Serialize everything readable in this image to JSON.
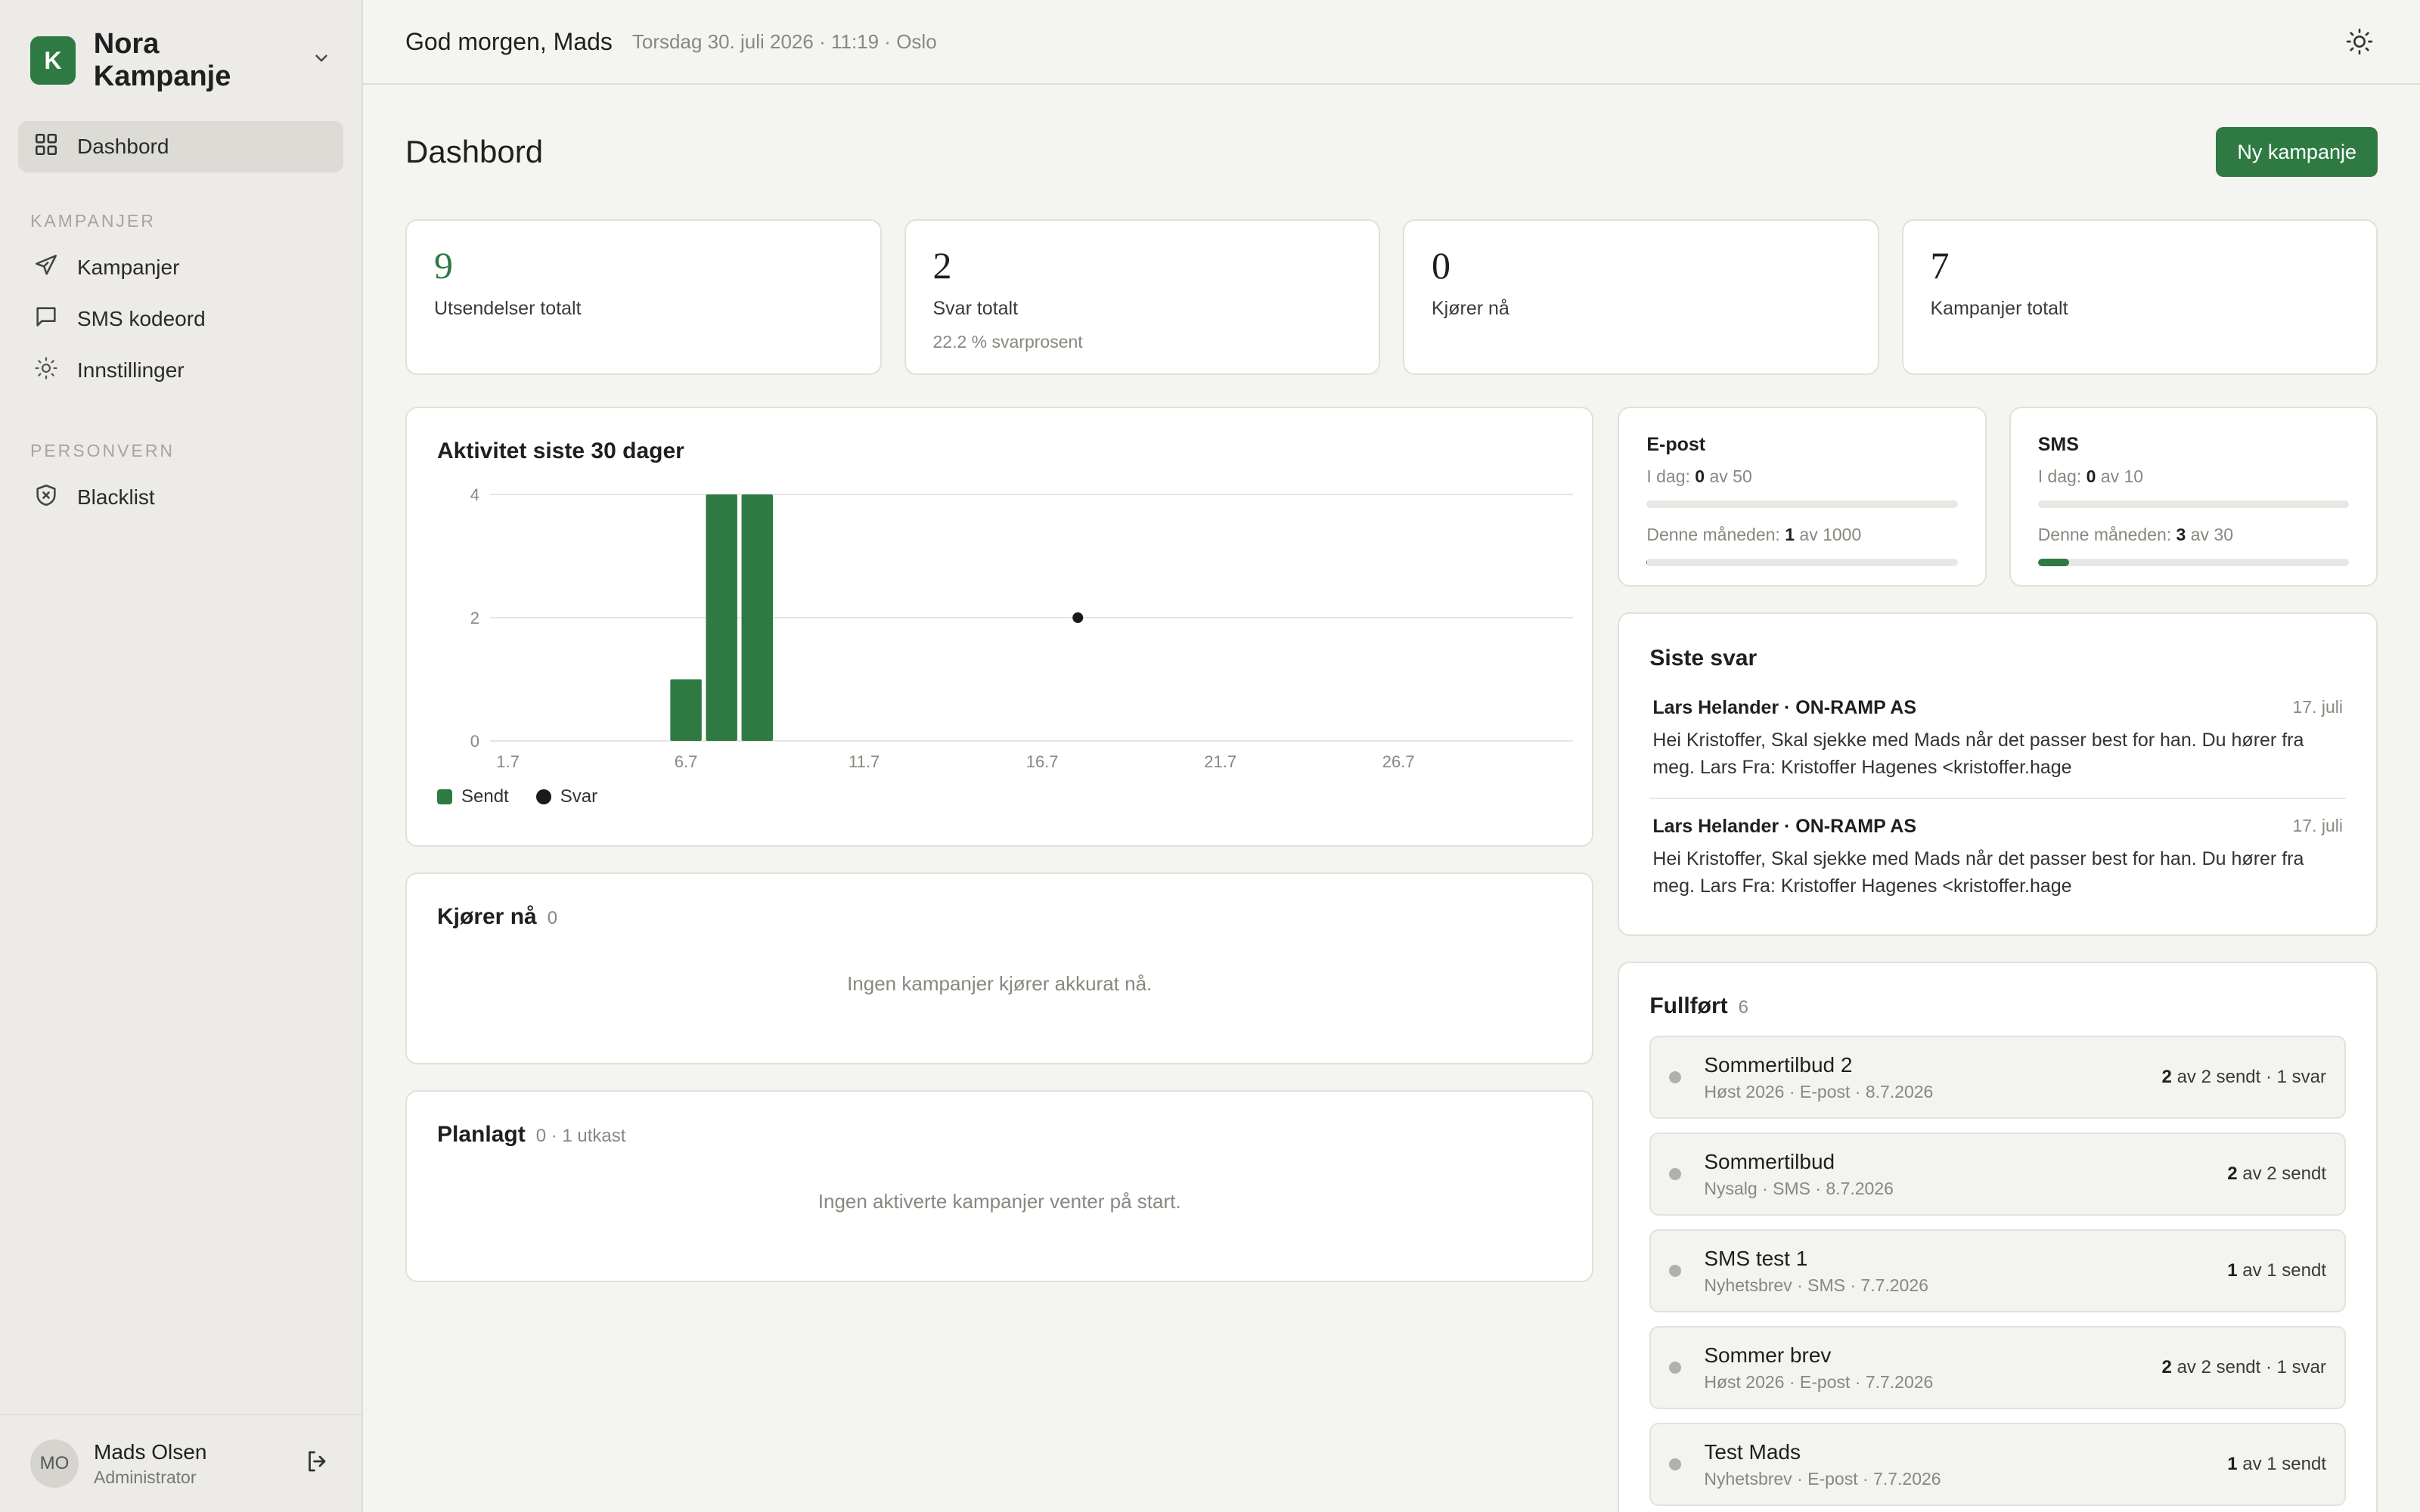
{
  "brand": {
    "logo_letter": "K",
    "name": "Nora Kampanje"
  },
  "nav": {
    "dashboard": "Dashbord",
    "section_campaigns": "KAMPANJER",
    "campaigns": "Kampanjer",
    "sms_codes": "SMS kodeord",
    "settings": "Innstillinger",
    "section_privacy": "PERSONVERN",
    "blacklist": "Blacklist"
  },
  "user": {
    "initials": "MO",
    "name": "Mads Olsen",
    "role": "Administrator"
  },
  "topbar": {
    "greeting": "God morgen, Mads",
    "datetime": "Torsdag 30. juli 2026 · 11:19 · Oslo"
  },
  "page": {
    "title": "Dashbord",
    "new_campaign": "Ny kampanje"
  },
  "stats": [
    {
      "value": "9",
      "label": "Utsendelser totalt",
      "sub": ""
    },
    {
      "value": "2",
      "label": "Svar totalt",
      "sub": "22.2 % svarprosent"
    },
    {
      "value": "0",
      "label": "Kjører nå",
      "sub": ""
    },
    {
      "value": "7",
      "label": "Kampanjer totalt",
      "sub": ""
    }
  ],
  "activity": {
    "title": "Aktivitet siste 30 dager"
  },
  "chart_data": {
    "type": "bar",
    "title": "Aktivitet siste 30 dager",
    "x": [
      "1.7",
      "2.7",
      "3.7",
      "4.7",
      "5.7",
      "6.7",
      "7.7",
      "8.7",
      "9.7",
      "10.7",
      "11.7",
      "12.7",
      "13.7",
      "14.7",
      "15.7",
      "16.7",
      "17.7",
      "18.7",
      "19.7",
      "20.7",
      "21.7",
      "22.7",
      "23.7",
      "24.7",
      "25.7",
      "26.7",
      "27.7",
      "28.7",
      "29.7",
      "30.7"
    ],
    "x_tick_labels": [
      "1.7",
      "6.7",
      "11.7",
      "16.7",
      "21.7",
      "26.7"
    ],
    "y_ticks": [
      0,
      2,
      4
    ],
    "ylim": [
      0,
      4
    ],
    "grid": true,
    "legend": "bottom-left",
    "series": [
      {
        "name": "Sendt",
        "type": "bar",
        "color": "#2f7a43",
        "values": [
          0,
          0,
          0,
          0,
          0,
          1,
          4,
          4,
          0,
          0,
          0,
          0,
          0,
          0,
          0,
          0,
          0,
          0,
          0,
          0,
          0,
          0,
          0,
          0,
          0,
          0,
          0,
          0,
          0,
          0
        ]
      },
      {
        "name": "Svar",
        "type": "scatter",
        "color": "#1a1a1a",
        "values": [
          0,
          0,
          0,
          0,
          0,
          0,
          0,
          0,
          0,
          0,
          0,
          0,
          0,
          0,
          0,
          0,
          2,
          0,
          0,
          0,
          0,
          0,
          0,
          0,
          0,
          0,
          0,
          0,
          0,
          0
        ]
      }
    ]
  },
  "running": {
    "title": "Kjører nå",
    "count": "0",
    "empty": "Ingen kampanjer kjører akkurat nå."
  },
  "planned": {
    "title": "Planlagt",
    "count": "0 · 1 utkast",
    "empty": "Ingen aktiverte kampanjer venter på start."
  },
  "limits": [
    {
      "title": "E-post",
      "day_prefix": "I dag:",
      "day_used": "0",
      "day_suffix": "av 50",
      "day_fraction": 0.0,
      "month_prefix": "Denne måneden:",
      "month_used": "1",
      "month_suffix": "av 1000",
      "month_fraction": 0.001
    },
    {
      "title": "SMS",
      "day_prefix": "I dag:",
      "day_used": "0",
      "day_suffix": "av 10",
      "day_fraction": 0.0,
      "month_prefix": "Denne måneden:",
      "month_used": "3",
      "month_suffix": "av 30",
      "month_fraction": 0.1
    }
  ],
  "replies": {
    "title": "Siste svar",
    "items": [
      {
        "from": "Lars Helander · ON-RAMP AS",
        "date": "17. juli",
        "body": "Hei Kristoffer, Skal sjekke med Mads når det passer best for han. Du hører fra meg. Lars Fra: Kristoffer Hagenes <kristoffer.hage"
      },
      {
        "from": "Lars Helander · ON-RAMP AS",
        "date": "17. juli",
        "body": "Hei Kristoffer, Skal sjekke med Mads når det passer best for han. Du hører fra meg. Lars Fra: Kristoffer Hagenes <kristoffer.hage"
      }
    ]
  },
  "completed": {
    "title": "Fullført",
    "count": "6",
    "items": [
      {
        "name": "Sommertilbud 2",
        "meta": "Høst 2026 · E-post · 8.7.2026",
        "sent": "2",
        "stat": "av 2 sendt · 1 svar"
      },
      {
        "name": "Sommertilbud",
        "meta": "Nysalg · SMS · 8.7.2026",
        "sent": "2",
        "stat": "av 2 sendt"
      },
      {
        "name": "SMS test 1",
        "meta": "Nyhetsbrev · SMS · 7.7.2026",
        "sent": "1",
        "stat": "av 1 sendt"
      },
      {
        "name": "Sommer brev",
        "meta": "Høst 2026 · E-post · 7.7.2026",
        "sent": "2",
        "stat": "av 2 sendt · 1 svar"
      },
      {
        "name": "Test Mads",
        "meta": "Nyhetsbrev · E-post · 7.7.2026",
        "sent": "1",
        "stat": "av 1 sendt"
      }
    ]
  }
}
